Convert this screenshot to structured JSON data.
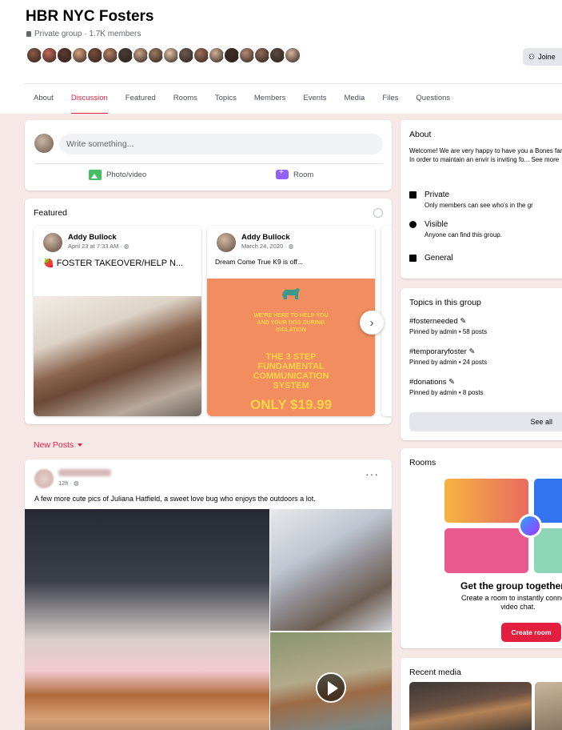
{
  "group": {
    "name": "HBR NYC Fosters",
    "meta": "Private group · 1.7K members",
    "joined_label": "Joine",
    "member_avatar_colors": [
      "#8a5a44",
      "#c46a5a",
      "#5e3a2e",
      "#d8a37f",
      "#7a4e3a",
      "#b9826a",
      "#4a3b35",
      "#caa48a",
      "#9c7a60",
      "#e2c2a8",
      "#6c5a52",
      "#a0705a",
      "#cfb095",
      "#3e2f28",
      "#b48c78",
      "#8e6b5a",
      "#5a4a42",
      "#d4b49c"
    ]
  },
  "tabs": [
    "About",
    "Discussion",
    "Featured",
    "Rooms",
    "Topics",
    "Members",
    "Events",
    "Media",
    "Files",
    "Questions"
  ],
  "active_tab": "Discussion",
  "composer": {
    "placeholder": "Write something...",
    "photo_label": "Photo/video",
    "room_label": "Room"
  },
  "featured": {
    "title": "Featured",
    "cards": [
      {
        "author": "Addy Bullock",
        "date": "April 23 at 7:33 AM · ◍",
        "text": "🍓 FOSTER TAKEOVER/HELP N..."
      },
      {
        "author": "Addy Bullock",
        "date": "March 24, 2020 · ◍",
        "text": "Dream Come True K9 is off...",
        "promo": {
          "line1": "WE'RE HERE TO HELP YOU",
          "line2": "AND YOUR DOG DURING",
          "line3": "ISOLATION",
          "line4": "THE 3 STEP",
          "line5": "FUNDAMENTAL",
          "line6": "COMMUNICATION",
          "line7": "SYSTEM",
          "price": "ONLY $19.99"
        }
      }
    ]
  },
  "new_posts_label": "New Posts",
  "post": {
    "time": "12h · ◍",
    "text": "A few more cute pics of Juliana Hatfield, a sweet love bug who enjoys the outdoors a lot.",
    "dots": "···"
  },
  "about": {
    "title": "About",
    "body": "Welcome! We are very happy to have you a Bones family! In order to maintain an envir is inviting fo... See more",
    "private_title": "Private",
    "private_sub": "Only members can see who's in the gr",
    "visible_title": "Visible",
    "visible_sub": "Anyone can find this group.",
    "general_title": "General"
  },
  "topics": {
    "title": "Topics in this group",
    "items": [
      {
        "name": "#fosterneeded ✎",
        "meta": "Pinned by admin • 58 posts"
      },
      {
        "name": "#temporaryfoster ✎",
        "meta": "Pinned by admin • 24 posts"
      },
      {
        "name": "#donations ✎",
        "meta": "Pinned by admin • 8 posts"
      }
    ],
    "see_all": "See all"
  },
  "rooms": {
    "title": "Rooms",
    "headline": "Get the group together c",
    "sub1": "Create a room to instantly connect t",
    "sub2": "video chat.",
    "create_label": "Create room"
  },
  "recent_media": {
    "title": "Recent media"
  },
  "colors": {
    "accent": "#e41e3f",
    "background": "#f7e8e8"
  }
}
